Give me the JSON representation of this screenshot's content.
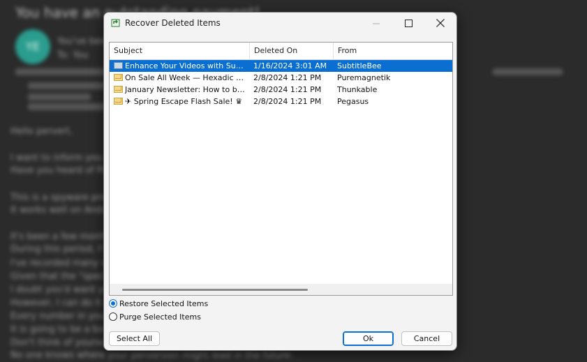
{
  "background": {
    "title": "You have an outstanding payment!",
    "avatar": "YE",
    "lines": [
      "You've been hacked",
      "To: You",
      "Hello pervert,",
      "I want to inform you about a very bad situation for you.",
      "Have you heard of Pegasus?",
      "This is a spyware program that installs remotely on devices and steals data.",
      "It works well on Android and iOS.",
      "It's been a few months since I hacked your device.",
      "During this period, I've been watching you.",
      "I've recorded many videos.",
      "Given that the \"specifics\" of your activity are known,",
      "I doubt you'd want your contacts to see.",
      "However, I can do it now.",
      "Every number in your contact list will receive it.",
      "It is going to be a bombshell.",
      "Don't think of yourself as a victim.",
      "No one knows where your perversion might lead in the future."
    ]
  },
  "dialog": {
    "title": "Recover Deleted Items",
    "columns": {
      "subject": "Subject",
      "deleted_on": "Deleted On",
      "from": "From"
    },
    "rows": [
      {
        "subject": "Enhance Your Videos with SubtitleBee",
        "deleted_on": "1/16/2024 3:01 AM",
        "from": "SubtitleBee"
      },
      {
        "subject": "On Sale All Week — Hexadic Synthesizer",
        "deleted_on": "2/8/2024 1:21 PM",
        "from": "Puremagnetik"
      },
      {
        "subject": "January Newsletter: How to build apps",
        "deleted_on": "2/8/2024 1:21 PM",
        "from": "Thunkable"
      },
      {
        "subject": "✈ Spring Escape Flash Sale! ♛",
        "deleted_on": "2/8/2024 1:21 PM",
        "from": "Pegasus"
      }
    ],
    "options": {
      "restore": "Restore Selected Items",
      "purge": "Purge Selected Items"
    },
    "buttons": {
      "select_all": "Select All",
      "ok": "Ok",
      "cancel": "Cancel"
    },
    "accent": "#0a6fd0"
  }
}
